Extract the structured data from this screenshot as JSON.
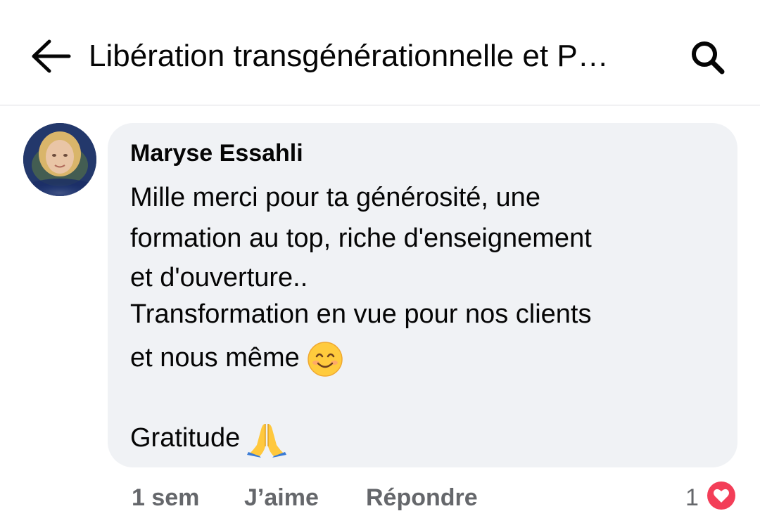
{
  "header": {
    "title": "Libération transgénérationnelle et P…",
    "back_icon": "arrow-left-icon",
    "search_icon": "search-icon"
  },
  "comment": {
    "author": "Maryse Essahli",
    "lines": [
      "Mille merci pour ta générosité, une",
      "formation au top, riche d'enseignement",
      "et d'ouverture..",
      "Transformation en vue pour nos clients",
      "et nous même",
      "Gratitude"
    ],
    "emoji_smile": "smiling-face-icon",
    "emoji_pray": "folded-hands-icon",
    "bubble_color": "#f0f2f5"
  },
  "footer": {
    "time": "1 sem",
    "like_label": "J’aime",
    "reply_label": "Répondre",
    "reaction_count": "1",
    "reaction_icon": "heart-icon",
    "reaction_color": "#f33e58"
  },
  "colors": {
    "text": "#050505",
    "secondary": "#65676b",
    "divider": "#dcdde1"
  }
}
